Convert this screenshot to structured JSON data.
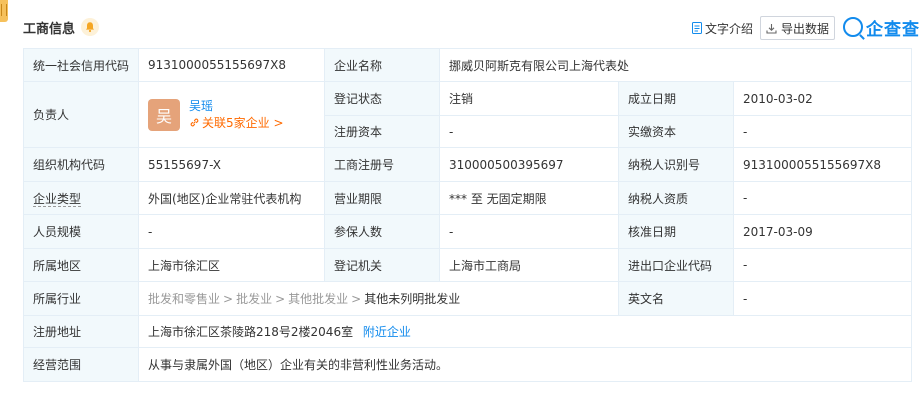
{
  "header": {
    "title": "工商信息",
    "doc_link_label": "文字介绍",
    "export_label": "导出数据",
    "brand": "企查查"
  },
  "table": {
    "credit_code_label": "统一社会信用代码",
    "credit_code": "9131000055155697X8",
    "company_name_label": "企业名称",
    "company_name": "挪威贝阿斯克有限公司上海代表处",
    "legal_rep_label": "负责人",
    "legal_rep": {
      "avatar_char": "吴",
      "name": "吴瑶",
      "related": "关联5家企业 >"
    },
    "reg_status_label": "登记状态",
    "reg_status": "注销",
    "est_date_label": "成立日期",
    "est_date": "2010-03-02",
    "reg_capital_label": "注册资本",
    "reg_capital": "-",
    "paid_capital_label": "实缴资本",
    "paid_capital": "-",
    "org_code_label": "组织机构代码",
    "org_code": "55155697-X",
    "reg_no_label": "工商注册号",
    "reg_no": "310000500395697",
    "taxpayer_id_label": "纳税人识别号",
    "taxpayer_id": "9131000055155697X8",
    "company_type_label": "企业类型",
    "company_type": "外国(地区)企业常驻代表机构",
    "business_term_label": "营业期限",
    "business_term": "*** 至 无固定期限",
    "taxpayer_qual_label": "纳税人资质",
    "taxpayer_qual": "-",
    "staff_size_label": "人员规模",
    "staff_size": "-",
    "insured_label": "参保人数",
    "insured": "-",
    "approval_date_label": "核准日期",
    "approval_date": "2017-03-09",
    "region_label": "所属地区",
    "region": "上海市徐汇区",
    "reg_authority_label": "登记机关",
    "reg_authority": "上海市工商局",
    "import_export_label": "进出口企业代码",
    "import_export": "-",
    "industry_label": "所属行业",
    "industry": [
      "批发和零售业",
      "批发业",
      "其他批发业",
      "其他未列明批发业"
    ],
    "industry_sep": ">",
    "english_name_label": "英文名",
    "english_name": "-",
    "address_label": "注册地址",
    "address": "上海市徐汇区茶陵路218号2楼2046室",
    "nearby_label": "附近企业",
    "scope_label": "经营范围",
    "scope": "从事与隶属外国（地区）企业有关的非营利性业务活动。"
  },
  "colors": {
    "accent": "#128bed",
    "label_bg": "#f2f9fc",
    "border": "#e4eef6",
    "related_orange": "#ff6a00",
    "avatar_bg": "#e5a37a"
  }
}
